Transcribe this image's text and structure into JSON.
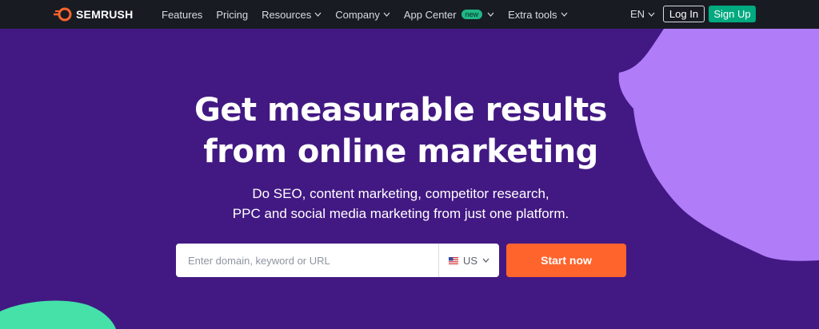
{
  "nav": {
    "brand": "SEMRUSH",
    "items": [
      {
        "label": "Features",
        "dropdown": false
      },
      {
        "label": "Pricing",
        "dropdown": false
      },
      {
        "label": "Resources",
        "dropdown": true
      },
      {
        "label": "Company",
        "dropdown": true
      },
      {
        "label": "App Center",
        "dropdown": true,
        "badge": "new"
      },
      {
        "label": "Extra tools",
        "dropdown": true
      }
    ],
    "language": "EN",
    "login_label": "Log In",
    "signup_label": "Sign Up"
  },
  "hero": {
    "title_line1": "Get measurable results",
    "title_line2": "from online marketing",
    "subtitle_line1": "Do SEO, content marketing, competitor research,",
    "subtitle_line2": "PPC and social media marketing from just one platform."
  },
  "search": {
    "placeholder": "Enter domain, keyword or URL",
    "database": "US",
    "submit_label": "Start now"
  },
  "colors": {
    "background": "#421983",
    "nav_bg": "#181b22",
    "accent_orange": "#ff642d",
    "signup_green": "#00a97f",
    "deco_lilac": "#b07cf8",
    "deco_green": "#45e1a9"
  },
  "icons": [
    "semrush-logo-icon",
    "chevron-down-icon",
    "us-flag-icon"
  ]
}
